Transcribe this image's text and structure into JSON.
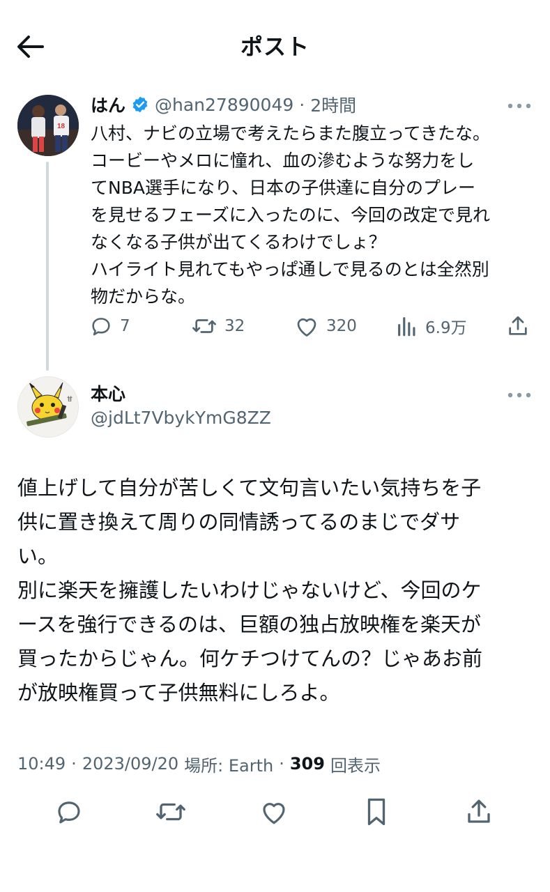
{
  "header": {
    "title": "ポスト",
    "back_icon": "arrow-left-icon"
  },
  "parent_post": {
    "display_name": "はん",
    "verified": true,
    "handle": "@han27890049",
    "separator": "·",
    "time": "2時間",
    "text": "八村、ナビの立場で考えたらまた腹立ってきたな。\nコービーやメロに憧れ、血の滲むような努力をし\nてNBA選手になり、日本の子供達に自分のプレー\nを見せるフェーズに入ったのに、今回の改定で見れ\nなくなる子供が出てくるわけでしょ？\nハイライト見れてもやっぱ通しで見るのとは全然別\n物だからな。",
    "actions": {
      "replies": "7",
      "reposts": "32",
      "likes": "320",
      "views": "6.9万"
    }
  },
  "reply_post": {
    "display_name": "本心",
    "handle": "@jdLt7VbykYmG8ZZ",
    "text": "値上げして自分が苦しくて文句言いたい気持ちを子\n供に置き換えて周りの同情誘ってるのまじでダサ\nい。\n別に楽天を擁護したいわけじゃないけど、今回のケ\nースを強行できるのは、巨額の独占放映権を楽天が\n買ったからじゃん。何ケチつけてんの？じゃあお前\nが放映権買って子供無料にしろよ。",
    "meta": {
      "time": "10:49",
      "sep1": "·",
      "date": "2023/09/20",
      "location": "場所: Earth",
      "sep2": "·",
      "views_count": "309",
      "views_label": "回表示"
    }
  },
  "colors": {
    "text": "#0f1419",
    "secondary": "#536471",
    "verified_blue": "#1d9bf0",
    "thread_line": "#cfd9de"
  }
}
